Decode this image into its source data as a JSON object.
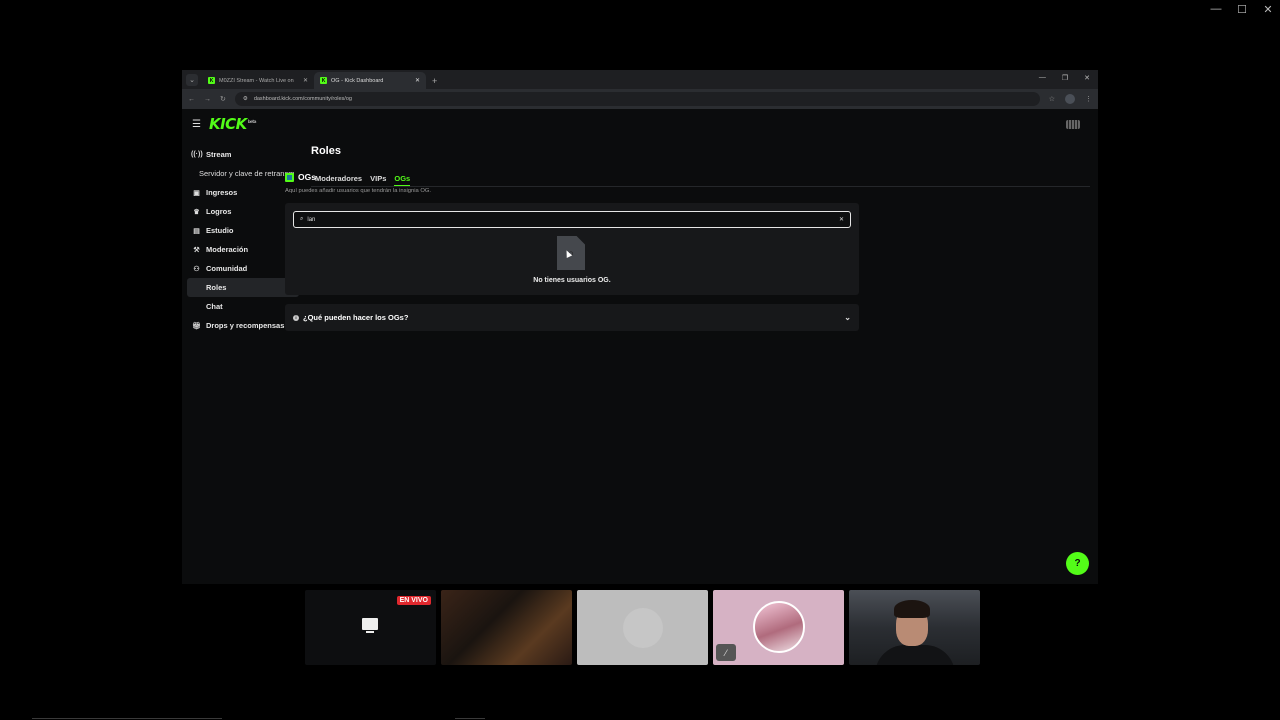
{
  "outer_window": {
    "minimize": "—",
    "maximize": "☐",
    "close": "✕"
  },
  "browser": {
    "tab_menu_icon": "chevron-down",
    "tabs": [
      {
        "title": "M0ZZI Stream - Watch Live on",
        "close": "✕"
      },
      {
        "title": "OG - Kick Dashboard",
        "close": "✕"
      }
    ],
    "new_tab": "+",
    "window_controls": {
      "minimize": "—",
      "maximize": "❐",
      "close": "✕"
    },
    "nav": {
      "back": "←",
      "forward": "→",
      "reload": "↻"
    },
    "url": "dashboard.kick.com/community/roles/og"
  },
  "app": {
    "logo": "KICK",
    "logo_tag": "beta",
    "brand_color": "#53fc18",
    "sidebar": {
      "items": [
        {
          "label": "Stream",
          "icon": "broadcast-icon"
        },
        {
          "label": "Servidor y clave de retransm"
        },
        {
          "label": "Ingresos",
          "icon": "wallet-icon"
        },
        {
          "label": "Logros",
          "icon": "trophy-icon"
        },
        {
          "label": "Estudio",
          "icon": "studio-icon",
          "chevron": "⌄"
        },
        {
          "label": "Moderación",
          "icon": "hammer-icon"
        },
        {
          "label": "Comunidad",
          "icon": "people-icon",
          "chevron": "⌃"
        },
        {
          "label": "Roles"
        },
        {
          "label": "Chat"
        },
        {
          "label": "Drops y recompensas",
          "icon": "gift-icon"
        }
      ]
    },
    "main": {
      "title": "Roles",
      "tabs": [
        "Moderadores",
        "VIPs",
        "OGs"
      ],
      "active_tab": "OGs",
      "section_title": "OGs",
      "section_desc": "Aquí puedes añadir usuarios que tendrán la insignia OG.",
      "search_value": "lan",
      "search_clear": "✕",
      "empty_text": "No tienes usuarios OG.",
      "faq_question": "¿Qué pueden hacer los OGs?",
      "faq_chevron": "⌄"
    }
  },
  "call": {
    "live_badge": "EN VIVO"
  }
}
